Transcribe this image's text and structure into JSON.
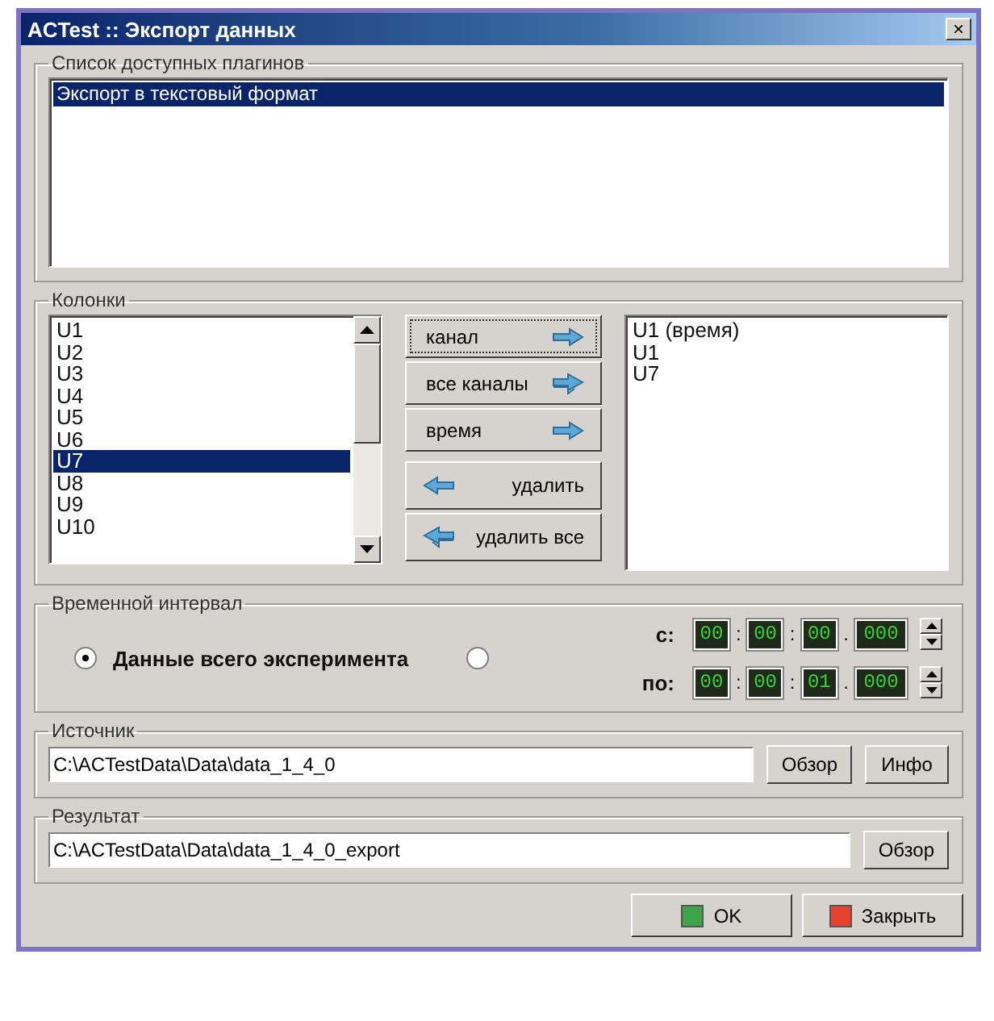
{
  "window": {
    "title": "ACTest :: Экспорт данных",
    "close": "×"
  },
  "plugins": {
    "legend": "Список доступных плагинов",
    "items": [
      {
        "label": "Экспорт в текстовый формат",
        "selected": true
      }
    ]
  },
  "columns": {
    "legend": "Колонки",
    "available": [
      {
        "label": "U1",
        "selected": false
      },
      {
        "label": "U2",
        "selected": false
      },
      {
        "label": "U3",
        "selected": false
      },
      {
        "label": "U4",
        "selected": false
      },
      {
        "label": "U5",
        "selected": false
      },
      {
        "label": "U6",
        "selected": false
      },
      {
        "label": "U7",
        "selected": true
      },
      {
        "label": "U8",
        "selected": false
      },
      {
        "label": "U9",
        "selected": false
      },
      {
        "label": "U10",
        "selected": false
      }
    ],
    "add_buttons": [
      {
        "label": "канал",
        "kind": "right",
        "focused": true
      },
      {
        "label": "все каналы",
        "kind": "double",
        "focused": false
      },
      {
        "label": "время",
        "kind": "right",
        "focused": false
      }
    ],
    "remove_buttons": [
      {
        "label": "удалить",
        "kind": "left"
      },
      {
        "label": "удалить все",
        "kind": "double"
      }
    ],
    "chosen": [
      "U1 (время)",
      "U1",
      "U7"
    ]
  },
  "interval": {
    "legend": "Временной интервал",
    "options": [
      {
        "label": "Данные всего эксперимента",
        "selected": true
      },
      {
        "selected": false
      }
    ],
    "ranges": [
      {
        "label": "с:",
        "segments": [
          "00",
          "00",
          "00",
          "000"
        ],
        "separators": [
          ":",
          ":",
          "."
        ]
      },
      {
        "label": "по:",
        "segments": [
          "00",
          "00",
          "01",
          "000"
        ],
        "separators": [
          ":",
          ":",
          "."
        ]
      }
    ]
  },
  "source": {
    "legend": "Источник",
    "value": "C:\\ACTestData\\Data\\data_1_4_0",
    "buttons": [
      "Обзор",
      "Инфо"
    ]
  },
  "result": {
    "legend": "Результат",
    "value": "C:\\ACTestData\\Data\\data_1_4_0_export",
    "buttons": [
      "Обзор"
    ]
  },
  "footer": [
    {
      "label": "OK",
      "kind": "ok"
    },
    {
      "label": "Закрыть",
      "kind": "close"
    }
  ]
}
